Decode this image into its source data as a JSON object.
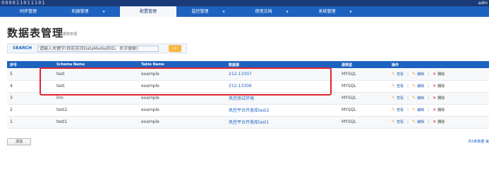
{
  "header": {
    "logo_text": "000011011101",
    "user": "adm"
  },
  "nav": {
    "items": [
      {
        "label": "同步管理",
        "active": false
      },
      {
        "label": "机器管理",
        "active": false
      },
      {
        "label": "配置管理",
        "active": true
      },
      {
        "label": "监控管理",
        "active": false
      },
      {
        "label": "使用文档",
        "active": false
      },
      {
        "label": "系统管理",
        "active": false
      }
    ],
    "caret": "▼"
  },
  "page": {
    "title": "数据表管理",
    "subtitle": "数据表管理"
  },
  "search": {
    "label": "SEARCH",
    "placeholder": "请输入关键字(目前支持DataMedia的ID、名字搜索)",
    "button_icon": "arrow-right-icon",
    "button_glyph": "⇨"
  },
  "table": {
    "headers": [
      "序号",
      "Schema Name",
      "Table Name",
      "数据源",
      "源类型",
      "操作"
    ],
    "rows": [
      {
        "id": "5",
        "schema": "test",
        "table": "example",
        "source": "212-13307",
        "type": "MYSQL"
      },
      {
        "id": "4",
        "schema": "test",
        "table": "example",
        "source": "212-13306",
        "type": "MYSQL"
      },
      {
        "id": "3",
        "schema": "lrm",
        "table": "example",
        "source": "风控测试环境",
        "type": "MYSQL"
      },
      {
        "id": "2",
        "schema": "test2",
        "table": "example",
        "source": "风控平台开发库test2",
        "type": "MYSQL"
      },
      {
        "id": "1",
        "schema": "test1",
        "table": "example",
        "source": "风控平台开发库test1",
        "type": "MYSQL"
      }
    ],
    "ops": {
      "view": "查看",
      "edit": "编辑",
      "delete": "删除",
      "separator": "|",
      "delete_glyph": "✕",
      "pencil_glyph": "✎"
    }
  },
  "footer": {
    "add_label": "添加",
    "pager_text": "共5条数据 第"
  },
  "colors": {
    "nav_bg": "#1e62bf",
    "topbar_bg": "#1a3a78",
    "highlight": "#e3242b",
    "search_button": "#f7b640"
  }
}
